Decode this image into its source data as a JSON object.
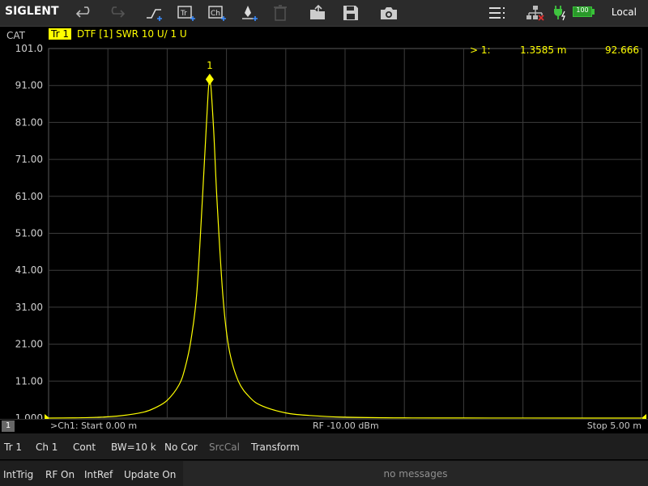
{
  "toolbar": {
    "logo": "SIGLENT",
    "icons": [
      "undo-icon",
      "redo-icon",
      "trace-add-icon",
      "trace-new-icon",
      "channel-new-icon",
      "marker-add-icon",
      "delete-icon",
      "open-icon",
      "save-icon",
      "camera-icon",
      "menu-icon",
      "network-icon",
      "power-plug-icon",
      "battery-icon"
    ],
    "battery_level": "100",
    "local_label": "Local"
  },
  "trace_header": {
    "cat": "CAT",
    "trace_badge": "Tr 1",
    "description": "DTF [1]  SWR  10 U/  1 U"
  },
  "marker": {
    "id": "1",
    "readout_label": "> 1:",
    "readout_x": "1.3585 m",
    "readout_y": "92.666"
  },
  "chart_data": {
    "type": "line",
    "y_tick_labels": [
      "101.0",
      "91.00",
      "81.00",
      "71.00",
      "61.00",
      "51.00",
      "41.00",
      "31.00",
      "21.00",
      "11.00",
      "1.000"
    ],
    "ylim": [
      1.0,
      101.0
    ],
    "xlim": [
      0.0,
      5.0
    ],
    "x_unit": "m",
    "grid": true,
    "series": [
      {
        "color": "#ffff00",
        "x": [
          0.0,
          0.2,
          0.4,
          0.6,
          0.8,
          0.9,
          1.0,
          1.1,
          1.15,
          1.2,
          1.25,
          1.3,
          1.33,
          1.3585,
          1.39,
          1.42,
          1.47,
          1.52,
          1.6,
          1.7,
          1.8,
          2.0,
          2.2,
          2.5,
          3.0,
          3.5,
          4.0,
          4.5,
          5.0
        ],
        "y": [
          1.0,
          1.05,
          1.2,
          1.6,
          2.6,
          3.8,
          5.8,
          10.0,
          14.5,
          22.0,
          35.0,
          62.0,
          80.0,
          92.666,
          80.0,
          60.0,
          34.0,
          20.0,
          11.0,
          6.5,
          4.3,
          2.4,
          1.7,
          1.25,
          1.05,
          1.02,
          1.01,
          1.0,
          1.0
        ]
      }
    ]
  },
  "channel_status": {
    "channel_number": "1",
    "start": ">Ch1: Start 0.00 m",
    "rf": "RF -10.00 dBm",
    "stop": "Stop 5.00 m"
  },
  "menu_row1": [
    "Tr 1",
    "Ch 1",
    "Cont",
    "BW=10 k",
    "No Cor",
    "SrcCal",
    "Transform"
  ],
  "menu_row2": [
    "IntTrig",
    "RF On",
    "IntRef",
    "Update On"
  ],
  "message": "no messages"
}
